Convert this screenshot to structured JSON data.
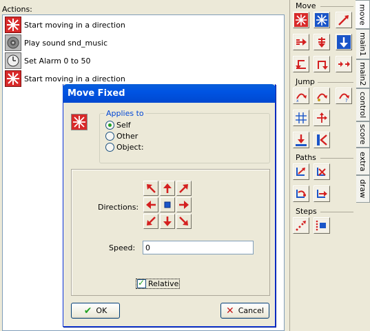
{
  "actions_panel": {
    "label": "Actions:",
    "items": [
      {
        "label": "Start moving in a direction",
        "icon": "move-fixed-icon"
      },
      {
        "label": "Play sound snd_music",
        "icon": "speaker-icon"
      },
      {
        "label": "Set Alarm 0 to 50",
        "icon": "alarm-clock-icon"
      },
      {
        "label": "Start moving in a direction",
        "icon": "move-fixed-icon"
      }
    ]
  },
  "library": {
    "sections": {
      "move": "Move",
      "jump": "Jump",
      "paths": "Paths",
      "steps": "Steps"
    }
  },
  "tabs": [
    "move",
    "main1",
    "main2",
    "control",
    "score",
    "extra",
    "draw"
  ],
  "dialog": {
    "title": "Move Fixed",
    "applies_to": {
      "legend": "Applies to",
      "options": [
        "Self",
        "Other",
        "Object:"
      ],
      "selected": "Self"
    },
    "directions_label": "Directions:",
    "speed_label": "Speed:",
    "speed_value": "0",
    "relative_label": "Relative",
    "relative_checked": true,
    "ok_label": "OK",
    "cancel_label": "Cancel"
  },
  "colors": {
    "accent_blue": "#0054e3",
    "icon_red": "#d42020",
    "icon_blue": "#1a55c8"
  }
}
